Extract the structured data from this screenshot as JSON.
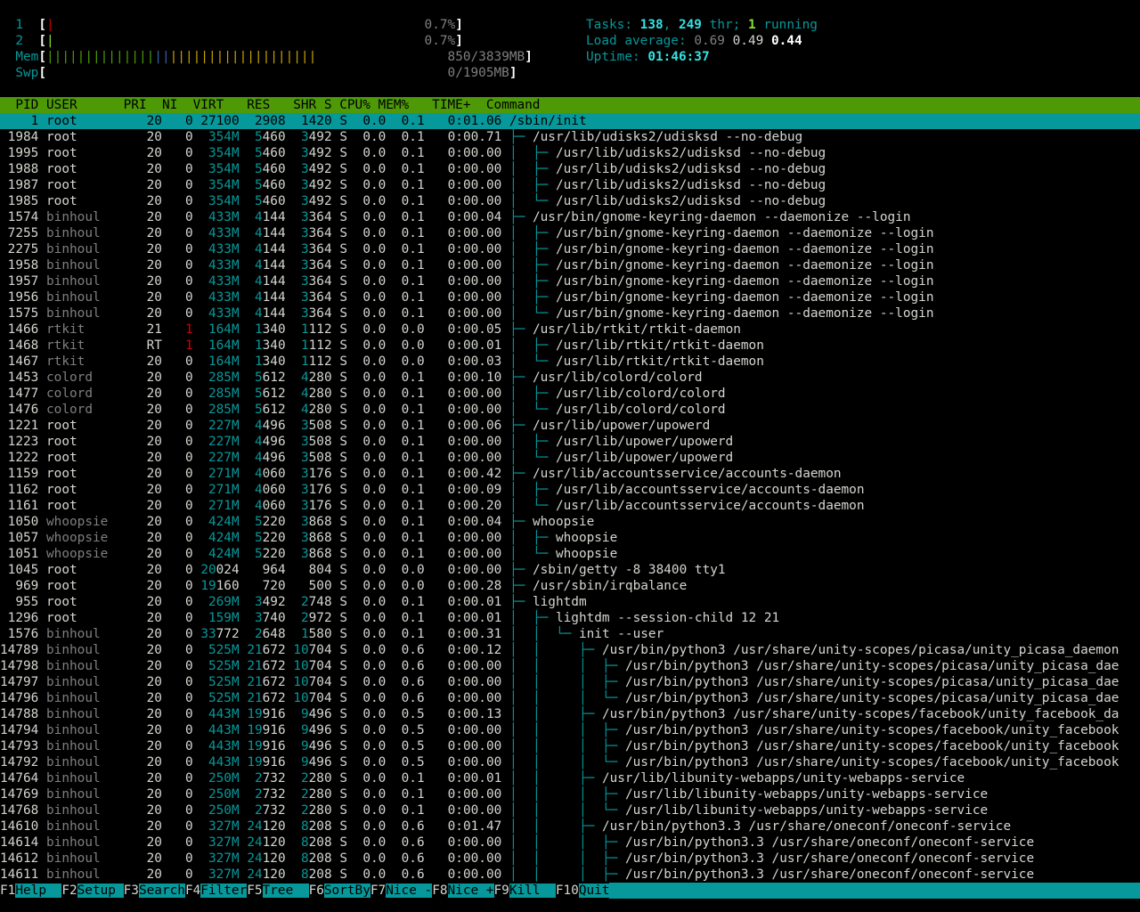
{
  "meters": {
    "cpu1": {
      "num": "1",
      "usage": "0.7%",
      "bar_red": "|"
    },
    "cpu2": {
      "num": "2",
      "usage": "0.7%",
      "bar_green": "|"
    },
    "mem": {
      "label": "Mem",
      "green": "||||||||||||||",
      "blue": "||",
      "yellow": "|||||||||||||||||||",
      "value": "850/3839MB"
    },
    "swp": {
      "label": "Swp",
      "value": "0/1905MB"
    },
    "tasks": {
      "label": "Tasks:",
      "count": "138",
      "thr": "249",
      "thr_label": "thr;",
      "running": "1",
      "running_label": "running"
    },
    "load": {
      "label": "Load average:",
      "l1": "0.69",
      "l5": "0.49",
      "l15": "0.44"
    },
    "uptime": {
      "label": "Uptime:",
      "value": "01:46:37"
    }
  },
  "columns": "  PID USER      PRI  NI  VIRT   RES   SHR S CPU% MEM%   TIME+  Command",
  "rows": [
    {
      "pid": "    1",
      "user": "root    ",
      "pri": "20",
      "ni": "0",
      "virt": "27100",
      "res": "2908",
      "shr": "1420",
      "s": "S",
      "cpu": "0.0",
      "mem": "0.1",
      "time": "0:01.06",
      "tree": "",
      "cmd": "/sbin/init",
      "selected": true
    },
    {
      "pid": " 1984",
      "user": "root    ",
      "pri": "20",
      "ni": "0",
      "virt": " 354M",
      "res": "5460",
      "shr": "3492",
      "s": "S",
      "cpu": "0.0",
      "mem": "0.1",
      "time": "0:00.71",
      "tree": "├─ ",
      "cmd": "/usr/lib/udisks2/udisksd --no-debug"
    },
    {
      "pid": " 1995",
      "user": "root    ",
      "pri": "20",
      "ni": "0",
      "virt": " 354M",
      "res": "5460",
      "shr": "3492",
      "s": "S",
      "cpu": "0.0",
      "mem": "0.1",
      "time": "0:00.00",
      "tree": "│  ├─ ",
      "cmd": "/usr/lib/udisks2/udisksd --no-debug"
    },
    {
      "pid": " 1988",
      "user": "root    ",
      "pri": "20",
      "ni": "0",
      "virt": " 354M",
      "res": "5460",
      "shr": "3492",
      "s": "S",
      "cpu": "0.0",
      "mem": "0.1",
      "time": "0:00.00",
      "tree": "│  ├─ ",
      "cmd": "/usr/lib/udisks2/udisksd --no-debug"
    },
    {
      "pid": " 1987",
      "user": "root    ",
      "pri": "20",
      "ni": "0",
      "virt": " 354M",
      "res": "5460",
      "shr": "3492",
      "s": "S",
      "cpu": "0.0",
      "mem": "0.1",
      "time": "0:00.00",
      "tree": "│  ├─ ",
      "cmd": "/usr/lib/udisks2/udisksd --no-debug"
    },
    {
      "pid": " 1985",
      "user": "root    ",
      "pri": "20",
      "ni": "0",
      "virt": " 354M",
      "res": "5460",
      "shr": "3492",
      "s": "S",
      "cpu": "0.0",
      "mem": "0.1",
      "time": "0:00.00",
      "tree": "│  └─ ",
      "cmd": "/usr/lib/udisks2/udisksd --no-debug"
    },
    {
      "pid": " 1574",
      "user": "binhoul ",
      "pri": "20",
      "ni": "0",
      "virt": " 433M",
      "res": "4144",
      "shr": "3364",
      "s": "S",
      "cpu": "0.0",
      "mem": "0.1",
      "time": "0:00.04",
      "tree": "├─ ",
      "cmd": "/usr/bin/gnome-keyring-daemon --daemonize --login"
    },
    {
      "pid": " 7255",
      "user": "binhoul ",
      "pri": "20",
      "ni": "0",
      "virt": " 433M",
      "res": "4144",
      "shr": "3364",
      "s": "S",
      "cpu": "0.0",
      "mem": "0.1",
      "time": "0:00.00",
      "tree": "│  ├─ ",
      "cmd": "/usr/bin/gnome-keyring-daemon --daemonize --login"
    },
    {
      "pid": " 2275",
      "user": "binhoul ",
      "pri": "20",
      "ni": "0",
      "virt": " 433M",
      "res": "4144",
      "shr": "3364",
      "s": "S",
      "cpu": "0.0",
      "mem": "0.1",
      "time": "0:00.00",
      "tree": "│  ├─ ",
      "cmd": "/usr/bin/gnome-keyring-daemon --daemonize --login"
    },
    {
      "pid": " 1958",
      "user": "binhoul ",
      "pri": "20",
      "ni": "0",
      "virt": " 433M",
      "res": "4144",
      "shr": "3364",
      "s": "S",
      "cpu": "0.0",
      "mem": "0.1",
      "time": "0:00.00",
      "tree": "│  ├─ ",
      "cmd": "/usr/bin/gnome-keyring-daemon --daemonize --login"
    },
    {
      "pid": " 1957",
      "user": "binhoul ",
      "pri": "20",
      "ni": "0",
      "virt": " 433M",
      "res": "4144",
      "shr": "3364",
      "s": "S",
      "cpu": "0.0",
      "mem": "0.1",
      "time": "0:00.00",
      "tree": "│  ├─ ",
      "cmd": "/usr/bin/gnome-keyring-daemon --daemonize --login"
    },
    {
      "pid": " 1956",
      "user": "binhoul ",
      "pri": "20",
      "ni": "0",
      "virt": " 433M",
      "res": "4144",
      "shr": "3364",
      "s": "S",
      "cpu": "0.0",
      "mem": "0.1",
      "time": "0:00.00",
      "tree": "│  ├─ ",
      "cmd": "/usr/bin/gnome-keyring-daemon --daemonize --login"
    },
    {
      "pid": " 1575",
      "user": "binhoul ",
      "pri": "20",
      "ni": "0",
      "virt": " 433M",
      "res": "4144",
      "shr": "3364",
      "s": "S",
      "cpu": "0.0",
      "mem": "0.1",
      "time": "0:00.00",
      "tree": "│  └─ ",
      "cmd": "/usr/bin/gnome-keyring-daemon --daemonize --login"
    },
    {
      "pid": " 1466",
      "user": "rtkit   ",
      "pri": "21",
      "ni": "1",
      "virt": " 164M",
      "res": "1340",
      "shr": "1112",
      "s": "S",
      "cpu": "0.0",
      "mem": "0.0",
      "time": "0:00.05",
      "tree": "├─ ",
      "cmd": "/usr/lib/rtkit/rtkit-daemon",
      "nired": true
    },
    {
      "pid": " 1468",
      "user": "rtkit   ",
      "pri": "RT",
      "ni": "1",
      "virt": " 164M",
      "res": "1340",
      "shr": "1112",
      "s": "S",
      "cpu": "0.0",
      "mem": "0.0",
      "time": "0:00.01",
      "tree": "│  ├─ ",
      "cmd": "/usr/lib/rtkit/rtkit-daemon",
      "nired": true
    },
    {
      "pid": " 1467",
      "user": "rtkit   ",
      "pri": "20",
      "ni": "0",
      "virt": " 164M",
      "res": "1340",
      "shr": "1112",
      "s": "S",
      "cpu": "0.0",
      "mem": "0.0",
      "time": "0:00.03",
      "tree": "│  └─ ",
      "cmd": "/usr/lib/rtkit/rtkit-daemon"
    },
    {
      "pid": " 1453",
      "user": "colord  ",
      "pri": "20",
      "ni": "0",
      "virt": " 285M",
      "res": "5612",
      "shr": "4280",
      "s": "S",
      "cpu": "0.0",
      "mem": "0.1",
      "time": "0:00.10",
      "tree": "├─ ",
      "cmd": "/usr/lib/colord/colord"
    },
    {
      "pid": " 1477",
      "user": "colord  ",
      "pri": "20",
      "ni": "0",
      "virt": " 285M",
      "res": "5612",
      "shr": "4280",
      "s": "S",
      "cpu": "0.0",
      "mem": "0.1",
      "time": "0:00.00",
      "tree": "│  ├─ ",
      "cmd": "/usr/lib/colord/colord"
    },
    {
      "pid": " 1476",
      "user": "colord  ",
      "pri": "20",
      "ni": "0",
      "virt": " 285M",
      "res": "5612",
      "shr": "4280",
      "s": "S",
      "cpu": "0.0",
      "mem": "0.1",
      "time": "0:00.00",
      "tree": "│  └─ ",
      "cmd": "/usr/lib/colord/colord"
    },
    {
      "pid": " 1221",
      "user": "root    ",
      "pri": "20",
      "ni": "0",
      "virt": " 227M",
      "res": "4496",
      "shr": "3508",
      "s": "S",
      "cpu": "0.0",
      "mem": "0.1",
      "time": "0:00.06",
      "tree": "├─ ",
      "cmd": "/usr/lib/upower/upowerd"
    },
    {
      "pid": " 1223",
      "user": "root    ",
      "pri": "20",
      "ni": "0",
      "virt": " 227M",
      "res": "4496",
      "shr": "3508",
      "s": "S",
      "cpu": "0.0",
      "mem": "0.1",
      "time": "0:00.00",
      "tree": "│  ├─ ",
      "cmd": "/usr/lib/upower/upowerd"
    },
    {
      "pid": " 1222",
      "user": "root    ",
      "pri": "20",
      "ni": "0",
      "virt": " 227M",
      "res": "4496",
      "shr": "3508",
      "s": "S",
      "cpu": "0.0",
      "mem": "0.1",
      "time": "0:00.00",
      "tree": "│  └─ ",
      "cmd": "/usr/lib/upower/upowerd"
    },
    {
      "pid": " 1159",
      "user": "root    ",
      "pri": "20",
      "ni": "0",
      "virt": " 271M",
      "res": "4060",
      "shr": "3176",
      "s": "S",
      "cpu": "0.0",
      "mem": "0.1",
      "time": "0:00.42",
      "tree": "├─ ",
      "cmd": "/usr/lib/accountsservice/accounts-daemon"
    },
    {
      "pid": " 1162",
      "user": "root    ",
      "pri": "20",
      "ni": "0",
      "virt": " 271M",
      "res": "4060",
      "shr": "3176",
      "s": "S",
      "cpu": "0.0",
      "mem": "0.1",
      "time": "0:00.09",
      "tree": "│  ├─ ",
      "cmd": "/usr/lib/accountsservice/accounts-daemon"
    },
    {
      "pid": " 1161",
      "user": "root    ",
      "pri": "20",
      "ni": "0",
      "virt": " 271M",
      "res": "4060",
      "shr": "3176",
      "s": "S",
      "cpu": "0.0",
      "mem": "0.1",
      "time": "0:00.20",
      "tree": "│  └─ ",
      "cmd": "/usr/lib/accountsservice/accounts-daemon"
    },
    {
      "pid": " 1050",
      "user": "whoopsie",
      "pri": "20",
      "ni": "0",
      "virt": " 424M",
      "res": "5220",
      "shr": "3868",
      "s": "S",
      "cpu": "0.0",
      "mem": "0.1",
      "time": "0:00.04",
      "tree": "├─ ",
      "cmd": "whoopsie"
    },
    {
      "pid": " 1057",
      "user": "whoopsie",
      "pri": "20",
      "ni": "0",
      "virt": " 424M",
      "res": "5220",
      "shr": "3868",
      "s": "S",
      "cpu": "0.0",
      "mem": "0.1",
      "time": "0:00.00",
      "tree": "│  ├─ ",
      "cmd": "whoopsie"
    },
    {
      "pid": " 1051",
      "user": "whoopsie",
      "pri": "20",
      "ni": "0",
      "virt": " 424M",
      "res": "5220",
      "shr": "3868",
      "s": "S",
      "cpu": "0.0",
      "mem": "0.1",
      "time": "0:00.00",
      "tree": "│  └─ ",
      "cmd": "whoopsie"
    },
    {
      "pid": " 1045",
      "user": "root    ",
      "pri": "20",
      "ni": "0",
      "virt": "20024",
      "res": " 964",
      "shr": " 804",
      "s": "S",
      "cpu": "0.0",
      "mem": "0.0",
      "time": "0:00.00",
      "tree": "├─ ",
      "cmd": "/sbin/getty -8 38400 tty1"
    },
    {
      "pid": "  969",
      "user": "root    ",
      "pri": "20",
      "ni": "0",
      "virt": "19160",
      "res": " 720",
      "shr": " 500",
      "s": "S",
      "cpu": "0.0",
      "mem": "0.0",
      "time": "0:00.28",
      "tree": "├─ ",
      "cmd": "/usr/sbin/irqbalance"
    },
    {
      "pid": "  955",
      "user": "root    ",
      "pri": "20",
      "ni": "0",
      "virt": " 269M",
      "res": "3492",
      "shr": "2748",
      "s": "S",
      "cpu": "0.0",
      "mem": "0.1",
      "time": "0:00.01",
      "tree": "├─ ",
      "cmd": "lightdm"
    },
    {
      "pid": " 1296",
      "user": "root    ",
      "pri": "20",
      "ni": "0",
      "virt": " 159M",
      "res": "3740",
      "shr": "2972",
      "s": "S",
      "cpu": "0.0",
      "mem": "0.1",
      "time": "0:00.01",
      "tree": "│  ├─ ",
      "cmd": "lightdm --session-child 12 21"
    },
    {
      "pid": " 1576",
      "user": "binhoul ",
      "pri": "20",
      "ni": "0",
      "virt": "33772",
      "res": "2648",
      "shr": "1580",
      "s": "S",
      "cpu": "0.0",
      "mem": "0.1",
      "time": "0:00.31",
      "tree": "│  │  └─ ",
      "cmd": "init --user"
    },
    {
      "pid": "14789",
      "user": "binhoul ",
      "pri": "20",
      "ni": "0",
      "virt": " 525M",
      "res": "21672",
      "shr": "10704",
      "s": "S",
      "cpu": "0.0",
      "mem": "0.6",
      "time": "0:00.12",
      "tree": "│  │     ├─ ",
      "cmd": "/usr/bin/python3 /usr/share/unity-scopes/picasa/unity_picasa_daemon"
    },
    {
      "pid": "14798",
      "user": "binhoul ",
      "pri": "20",
      "ni": "0",
      "virt": " 525M",
      "res": "21672",
      "shr": "10704",
      "s": "S",
      "cpu": "0.0",
      "mem": "0.6",
      "time": "0:00.00",
      "tree": "│  │     │  ├─ ",
      "cmd": "/usr/bin/python3 /usr/share/unity-scopes/picasa/unity_picasa_dae"
    },
    {
      "pid": "14797",
      "user": "binhoul ",
      "pri": "20",
      "ni": "0",
      "virt": " 525M",
      "res": "21672",
      "shr": "10704",
      "s": "S",
      "cpu": "0.0",
      "mem": "0.6",
      "time": "0:00.00",
      "tree": "│  │     │  ├─ ",
      "cmd": "/usr/bin/python3 /usr/share/unity-scopes/picasa/unity_picasa_dae"
    },
    {
      "pid": "14796",
      "user": "binhoul ",
      "pri": "20",
      "ni": "0",
      "virt": " 525M",
      "res": "21672",
      "shr": "10704",
      "s": "S",
      "cpu": "0.0",
      "mem": "0.6",
      "time": "0:00.00",
      "tree": "│  │     │  └─ ",
      "cmd": "/usr/bin/python3 /usr/share/unity-scopes/picasa/unity_picasa_dae"
    },
    {
      "pid": "14788",
      "user": "binhoul ",
      "pri": "20",
      "ni": "0",
      "virt": " 443M",
      "res": "19916",
      "shr": "9496",
      "s": "S",
      "cpu": "0.0",
      "mem": "0.5",
      "time": "0:00.13",
      "tree": "│  │     ├─ ",
      "cmd": "/usr/bin/python3 /usr/share/unity-scopes/facebook/unity_facebook_da"
    },
    {
      "pid": "14794",
      "user": "binhoul ",
      "pri": "20",
      "ni": "0",
      "virt": " 443M",
      "res": "19916",
      "shr": "9496",
      "s": "S",
      "cpu": "0.0",
      "mem": "0.5",
      "time": "0:00.00",
      "tree": "│  │     │  ├─ ",
      "cmd": "/usr/bin/python3 /usr/share/unity-scopes/facebook/unity_facebook"
    },
    {
      "pid": "14793",
      "user": "binhoul ",
      "pri": "20",
      "ni": "0",
      "virt": " 443M",
      "res": "19916",
      "shr": "9496",
      "s": "S",
      "cpu": "0.0",
      "mem": "0.5",
      "time": "0:00.00",
      "tree": "│  │     │  ├─ ",
      "cmd": "/usr/bin/python3 /usr/share/unity-scopes/facebook/unity_facebook"
    },
    {
      "pid": "14792",
      "user": "binhoul ",
      "pri": "20",
      "ni": "0",
      "virt": " 443M",
      "res": "19916",
      "shr": "9496",
      "s": "S",
      "cpu": "0.0",
      "mem": "0.5",
      "time": "0:00.00",
      "tree": "│  │     │  └─ ",
      "cmd": "/usr/bin/python3 /usr/share/unity-scopes/facebook/unity_facebook"
    },
    {
      "pid": "14764",
      "user": "binhoul ",
      "pri": "20",
      "ni": "0",
      "virt": " 250M",
      "res": "2732",
      "shr": "2280",
      "s": "S",
      "cpu": "0.0",
      "mem": "0.1",
      "time": "0:00.01",
      "tree": "│  │     ├─ ",
      "cmd": "/usr/lib/libunity-webapps/unity-webapps-service"
    },
    {
      "pid": "14769",
      "user": "binhoul ",
      "pri": "20",
      "ni": "0",
      "virt": " 250M",
      "res": "2732",
      "shr": "2280",
      "s": "S",
      "cpu": "0.0",
      "mem": "0.1",
      "time": "0:00.00",
      "tree": "│  │     │  ├─ ",
      "cmd": "/usr/lib/libunity-webapps/unity-webapps-service"
    },
    {
      "pid": "14768",
      "user": "binhoul ",
      "pri": "20",
      "ni": "0",
      "virt": " 250M",
      "res": "2732",
      "shr": "2280",
      "s": "S",
      "cpu": "0.0",
      "mem": "0.1",
      "time": "0:00.00",
      "tree": "│  │     │  └─ ",
      "cmd": "/usr/lib/libunity-webapps/unity-webapps-service"
    },
    {
      "pid": "14610",
      "user": "binhoul ",
      "pri": "20",
      "ni": "0",
      "virt": " 327M",
      "res": "24120",
      "shr": "8208",
      "s": "S",
      "cpu": "0.0",
      "mem": "0.6",
      "time": "0:01.47",
      "tree": "│  │     ├─ ",
      "cmd": "/usr/bin/python3.3 /usr/share/oneconf/oneconf-service"
    },
    {
      "pid": "14614",
      "user": "binhoul ",
      "pri": "20",
      "ni": "0",
      "virt": " 327M",
      "res": "24120",
      "shr": "8208",
      "s": "S",
      "cpu": "0.0",
      "mem": "0.6",
      "time": "0:00.00",
      "tree": "│  │     │  ├─ ",
      "cmd": "/usr/bin/python3.3 /usr/share/oneconf/oneconf-service"
    },
    {
      "pid": "14612",
      "user": "binhoul ",
      "pri": "20",
      "ni": "0",
      "virt": " 327M",
      "res": "24120",
      "shr": "8208",
      "s": "S",
      "cpu": "0.0",
      "mem": "0.6",
      "time": "0:00.00",
      "tree": "│  │     │  ├─ ",
      "cmd": "/usr/bin/python3.3 /usr/share/oneconf/oneconf-service"
    },
    {
      "pid": "14611",
      "user": "binhoul ",
      "pri": "20",
      "ni": "0",
      "virt": " 327M",
      "res": "24120",
      "shr": "8208",
      "s": "S",
      "cpu": "0.0",
      "mem": "0.6",
      "time": "0:00.00",
      "tree": "│  │     │  ├─ ",
      "cmd": "/usr/bin/python3.3 /usr/share/oneconf/oneconf-service"
    }
  ],
  "function_keys": [
    {
      "key": "F1",
      "label": "Help  "
    },
    {
      "key": "F2",
      "label": "Setup "
    },
    {
      "key": "F3",
      "label": "Search"
    },
    {
      "key": "F4",
      "label": "Filter"
    },
    {
      "key": "F5",
      "label": "Tree  "
    },
    {
      "key": "F6",
      "label": "SortBy"
    },
    {
      "key": "F7",
      "label": "Nice -"
    },
    {
      "key": "F8",
      "label": "Nice +"
    },
    {
      "key": "F9",
      "label": "Kill  "
    },
    {
      "key": "F10",
      "label": "Quit"
    }
  ],
  "colors": {
    "header_bg": "#4e9a06",
    "selected_bg": "#06989a",
    "cyan": "#06989a",
    "bright_cyan": "#34e2e2"
  }
}
